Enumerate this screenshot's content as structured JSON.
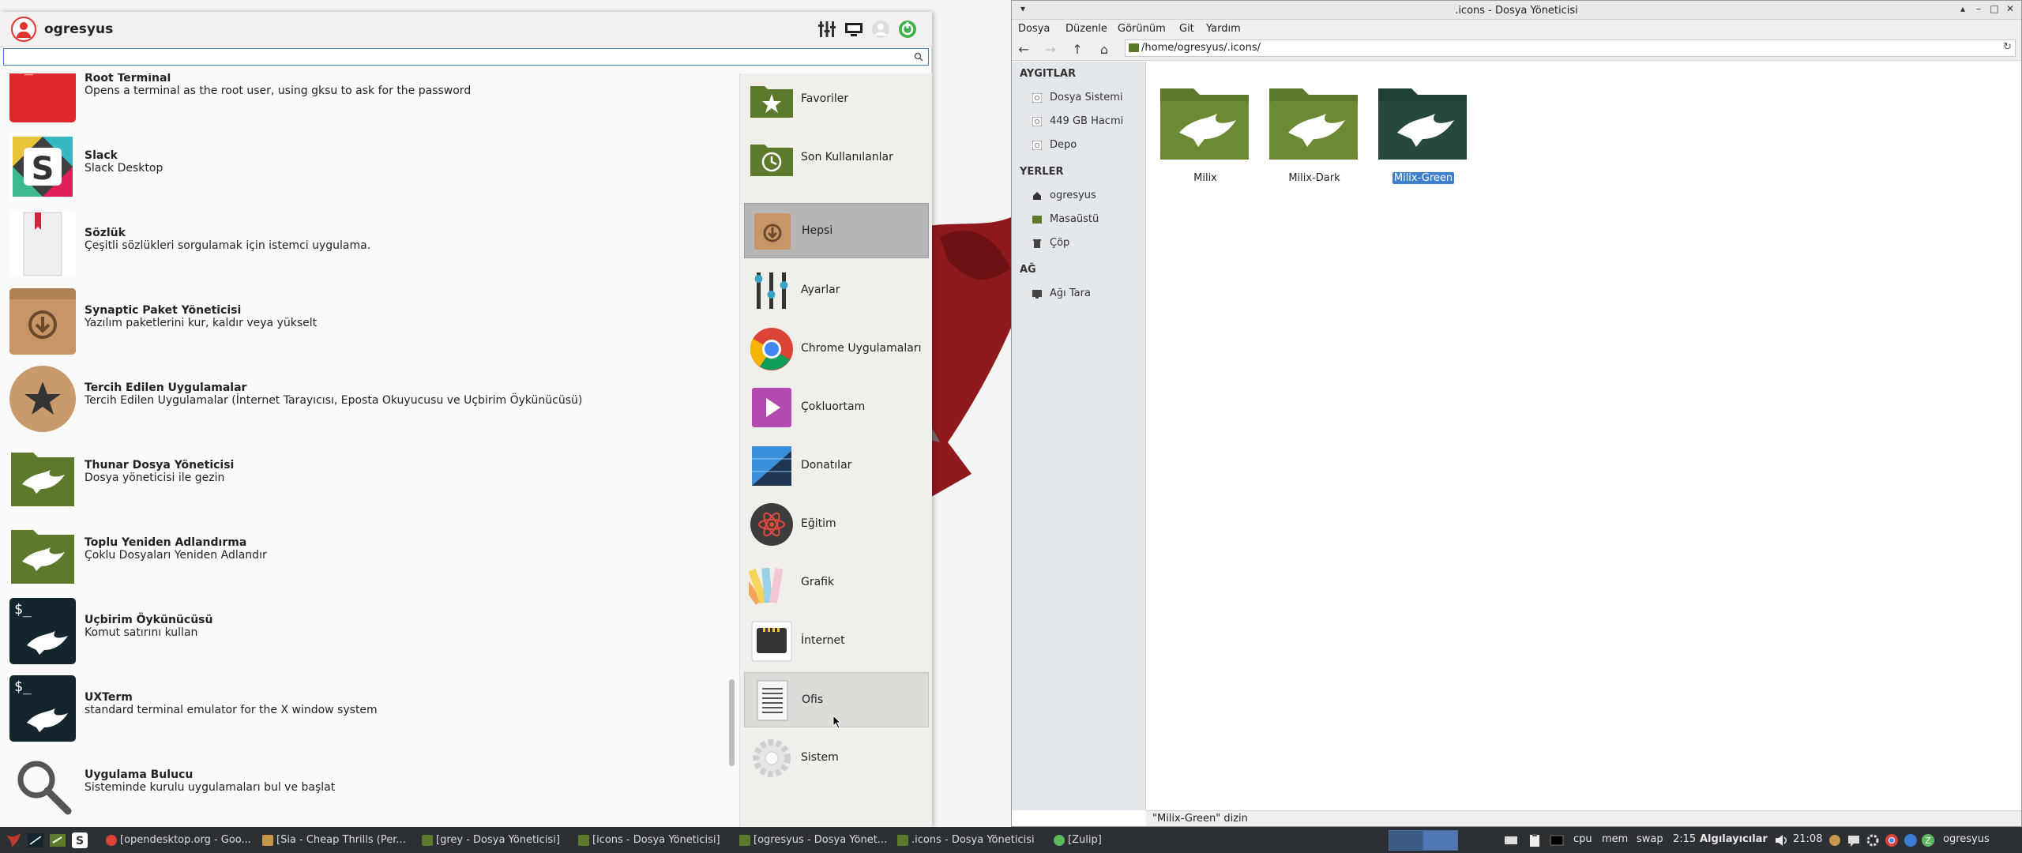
{
  "menu": {
    "username": "ogresyus",
    "search": {
      "value": "",
      "placeholder": ""
    },
    "header_icons": [
      "settings-mixer-icon",
      "switch-user-icon",
      "lock-screen-icon",
      "logout-icon"
    ],
    "apps": [
      {
        "name": "Root Terminal",
        "desc": "Opens a terminal as the root user, using gksu to ask for the password",
        "icon": "terminal-red-icon"
      },
      {
        "name": "Slack",
        "desc": "Slack Desktop",
        "icon": "slack-icon"
      },
      {
        "name": "Sözlük",
        "desc": "Çeşitli sözlükleri sorgulamak için istemci uygulama.",
        "icon": "dictionary-icon"
      },
      {
        "name": "Synaptic Paket Yöneticisi",
        "desc": "Yazılım paketlerini kur, kaldır veya yükselt",
        "icon": "package-manager-icon"
      },
      {
        "name": "Tercih Edilen Uygulamalar",
        "desc": "Tercih Edilen Uygulamalar (İnternet Tarayıcısı, Eposta Okuyucusu ve Uçbirim Öykünücüsü)",
        "icon": "preferred-apps-icon"
      },
      {
        "name": "Thunar Dosya Yöneticisi",
        "desc": "Dosya yöneticisi ile gezin",
        "icon": "thunar-folder-icon"
      },
      {
        "name": "Toplu Yeniden Adlandırma",
        "desc": "Çoklu Dosyaları Yeniden Adlandır",
        "icon": "bulk-rename-icon"
      },
      {
        "name": "Uçbirim Öykünücüsü",
        "desc": "Komut satırını kullan",
        "icon": "terminal-dark-icon"
      },
      {
        "name": "UXTerm",
        "desc": "standard terminal emulator for the X window system",
        "icon": "uxterm-icon"
      },
      {
        "name": "Uygulama Bulucu",
        "desc": "Sisteminde kurulu uygulamaları bul ve başlat",
        "icon": "app-finder-icon"
      }
    ],
    "categories": [
      {
        "label": "Favoriler",
        "icon": "favorites-star-icon"
      },
      {
        "label": "Son Kullanılanlar",
        "icon": "recent-clock-icon"
      },
      {
        "label": "Hepsi",
        "icon": "all-apps-icon",
        "selected": true
      },
      {
        "label": "Ayarlar",
        "icon": "settings-sliders-icon"
      },
      {
        "label": "Chrome Uygulamaları",
        "icon": "chrome-icon"
      },
      {
        "label": "Çokluortam",
        "icon": "multimedia-icon"
      },
      {
        "label": "Donatılar",
        "icon": "accessories-icon"
      },
      {
        "label": "Eğitim",
        "icon": "education-icon"
      },
      {
        "label": "Grafik",
        "icon": "graphics-icon"
      },
      {
        "label": "İnternet",
        "icon": "internet-icon"
      },
      {
        "label": "Ofis",
        "icon": "office-icon",
        "hovered": true
      },
      {
        "label": "Sistem",
        "icon": "system-gear-icon"
      }
    ]
  },
  "file_manager": {
    "title": ".icons - Dosya Yöneticisi",
    "menubar": [
      "Dosya",
      "Düzenle",
      "Görünüm",
      "Git",
      "Yardım"
    ],
    "location": "/home/ogresyus/.icons/",
    "sidebar": {
      "devices_header": "AYGITLAR",
      "devices": [
        "Dosya Sistemi",
        "449 GB Hacmi",
        "Depo"
      ],
      "places_header": "YERLER",
      "places": [
        "ogresyus",
        "Masaüstü",
        "Çöp"
      ],
      "network_header": "AĞ",
      "network": [
        "Ağı Tara"
      ]
    },
    "folders": [
      {
        "name": "Milix",
        "color": "#5d7a2c",
        "selected": false
      },
      {
        "name": "Milix-Dark",
        "color": "#5d7a2c",
        "selected": false
      },
      {
        "name": "Milix-Green",
        "color": "#1f4034",
        "selected": true
      }
    ],
    "status": "\"Milix-Green\" dizin"
  },
  "panel": {
    "tasks": [
      {
        "label": "[opendesktop.org - Goo...",
        "icon": "chrome-icon"
      },
      {
        "label": "[Sia - Cheap Thrills (Per...",
        "icon": "music-icon"
      },
      {
        "label": "[grey - Dosya Yöneticisi]",
        "icon": "folder-icon"
      },
      {
        "label": "[icons - Dosya Yöneticisi]",
        "icon": "folder-icon"
      },
      {
        "label": "[ogresyus - Dosya Yönet...",
        "icon": "folder-icon"
      },
      {
        "label": ".icons - Dosya Yöneticisi",
        "icon": "folder-icon"
      },
      {
        "label": "[Zulip]",
        "icon": "zulip-icon"
      }
    ],
    "tray": {
      "cpu": "cpu",
      "mem": "mem",
      "swap": "swap",
      "battery": "2:15",
      "sensors": "Algılayıcılar",
      "clock": "21:08",
      "user": "ogresyus"
    }
  },
  "colors": {
    "accent": "#3c7fcf",
    "brand_red": "#8e1a1e",
    "folder_green": "#5d7a2c",
    "folder_dark_green": "#1f4034"
  }
}
